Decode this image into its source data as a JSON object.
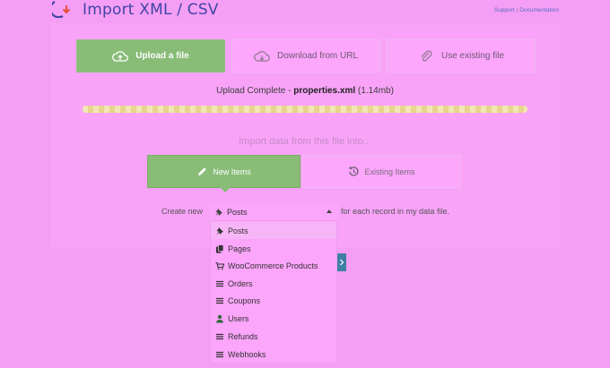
{
  "header": {
    "title": "Import XML / CSV",
    "links": {
      "support": "Support",
      "separator": "|",
      "documentation": "Documentation"
    }
  },
  "source_tabs": [
    {
      "label": "Upload a file",
      "icon": "upload-icon",
      "active": true
    },
    {
      "label": "Download from URL",
      "icon": "cloud-download-icon",
      "active": false
    },
    {
      "label": "Use existing file",
      "icon": "paperclip-icon",
      "active": false
    }
  ],
  "upload": {
    "status_prefix": "Upload Complete - ",
    "file_name": "properties.xml",
    "file_size": "(1.14mb)",
    "progress_percent": 100
  },
  "import_heading": "Import data from this file into...",
  "target_tabs": [
    {
      "label": "New Items",
      "icon": "pencil-icon",
      "active": true
    },
    {
      "label": "Existing Items",
      "icon": "history-icon",
      "active": false
    }
  ],
  "create_row": {
    "prefix": "Create new",
    "selected": "Posts",
    "selected_icon": "pin-icon",
    "suffix": "for each record in my data file."
  },
  "dropdown": {
    "options": [
      {
        "label": "Posts",
        "icon": "pin-icon",
        "selected": true
      },
      {
        "label": "Pages",
        "icon": "pages-icon",
        "selected": false
      },
      {
        "label": "WooCommerce Products",
        "icon": "cart-icon",
        "selected": false
      },
      {
        "label": "Orders",
        "icon": "list-icon",
        "selected": false
      },
      {
        "label": "Coupons",
        "icon": "list-icon",
        "selected": false
      },
      {
        "label": "Users",
        "icon": "user-icon",
        "selected": false
      },
      {
        "label": "Refunds",
        "icon": "list-icon",
        "selected": false
      },
      {
        "label": "Webhooks",
        "icon": "list-icon",
        "selected": false
      }
    ]
  },
  "colors": {
    "background": "#f59ef5",
    "active_tab": "#88bc77",
    "title": "#3f46a6",
    "progress": "#eddb9b",
    "button_blue": "#3f7fa4"
  }
}
